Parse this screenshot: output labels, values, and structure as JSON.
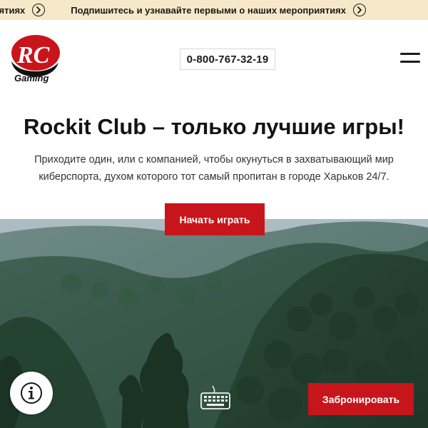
{
  "banner": {
    "items": [
      "мероприятиях",
      "Подпишитесь и узнавайте первыми о наших мероприятиях"
    ],
    "arrow_icon": "chevron-right-circle-icon"
  },
  "header": {
    "logo": {
      "letters": "RC",
      "sub": "Gaming"
    },
    "phone": "0-800-767-32-19",
    "menu_icon": "hamburger-menu-icon"
  },
  "hero": {
    "title": "Rockit Club – только лучшие игры!",
    "description": "Приходите один, или с компанией, чтобы окунуться в захватывающий мир киберспорта, духом которого тот самый пропитан в городе Харьков 24/7.",
    "cta_label": "Начать играть"
  },
  "footer_actions": {
    "info_icon": "info-icon",
    "keyboard_icon": "keyboard-icon",
    "book_label": "Забронировать"
  },
  "colors": {
    "accent": "#c8151b",
    "banner_bg": "#f7e8c9",
    "text_dark": "#141414"
  }
}
